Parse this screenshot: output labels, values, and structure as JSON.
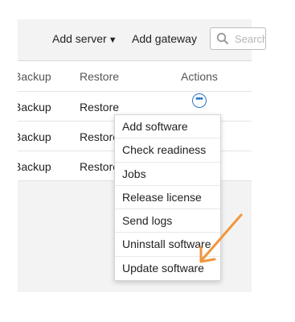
{
  "toolbar": {
    "add_server_label": "Add server",
    "add_gateway_label": "Add gateway",
    "search_placeholder": "Search"
  },
  "table": {
    "headers": {
      "backup": "Backup",
      "restore": "Restore",
      "actions": "Actions"
    },
    "rows": [
      {
        "backup": "Backup",
        "restore": "Restore"
      },
      {
        "backup": "Backup",
        "restore": "Restore"
      },
      {
        "backup": "Backup",
        "restore": "Restore"
      }
    ]
  },
  "actions_menu": {
    "items": [
      "Add software",
      "Check readiness",
      "Jobs",
      "Release license",
      "Send logs",
      "Uninstall software",
      "Update software"
    ]
  },
  "colors": {
    "accent": "#2a73c8",
    "annotation_arrow": "#f0963c",
    "panel_bg": "#f3f3f3"
  },
  "icons": {
    "actions": "ellipsis-circle-icon",
    "search": "search-icon",
    "dropdown": "caret-down-icon"
  }
}
